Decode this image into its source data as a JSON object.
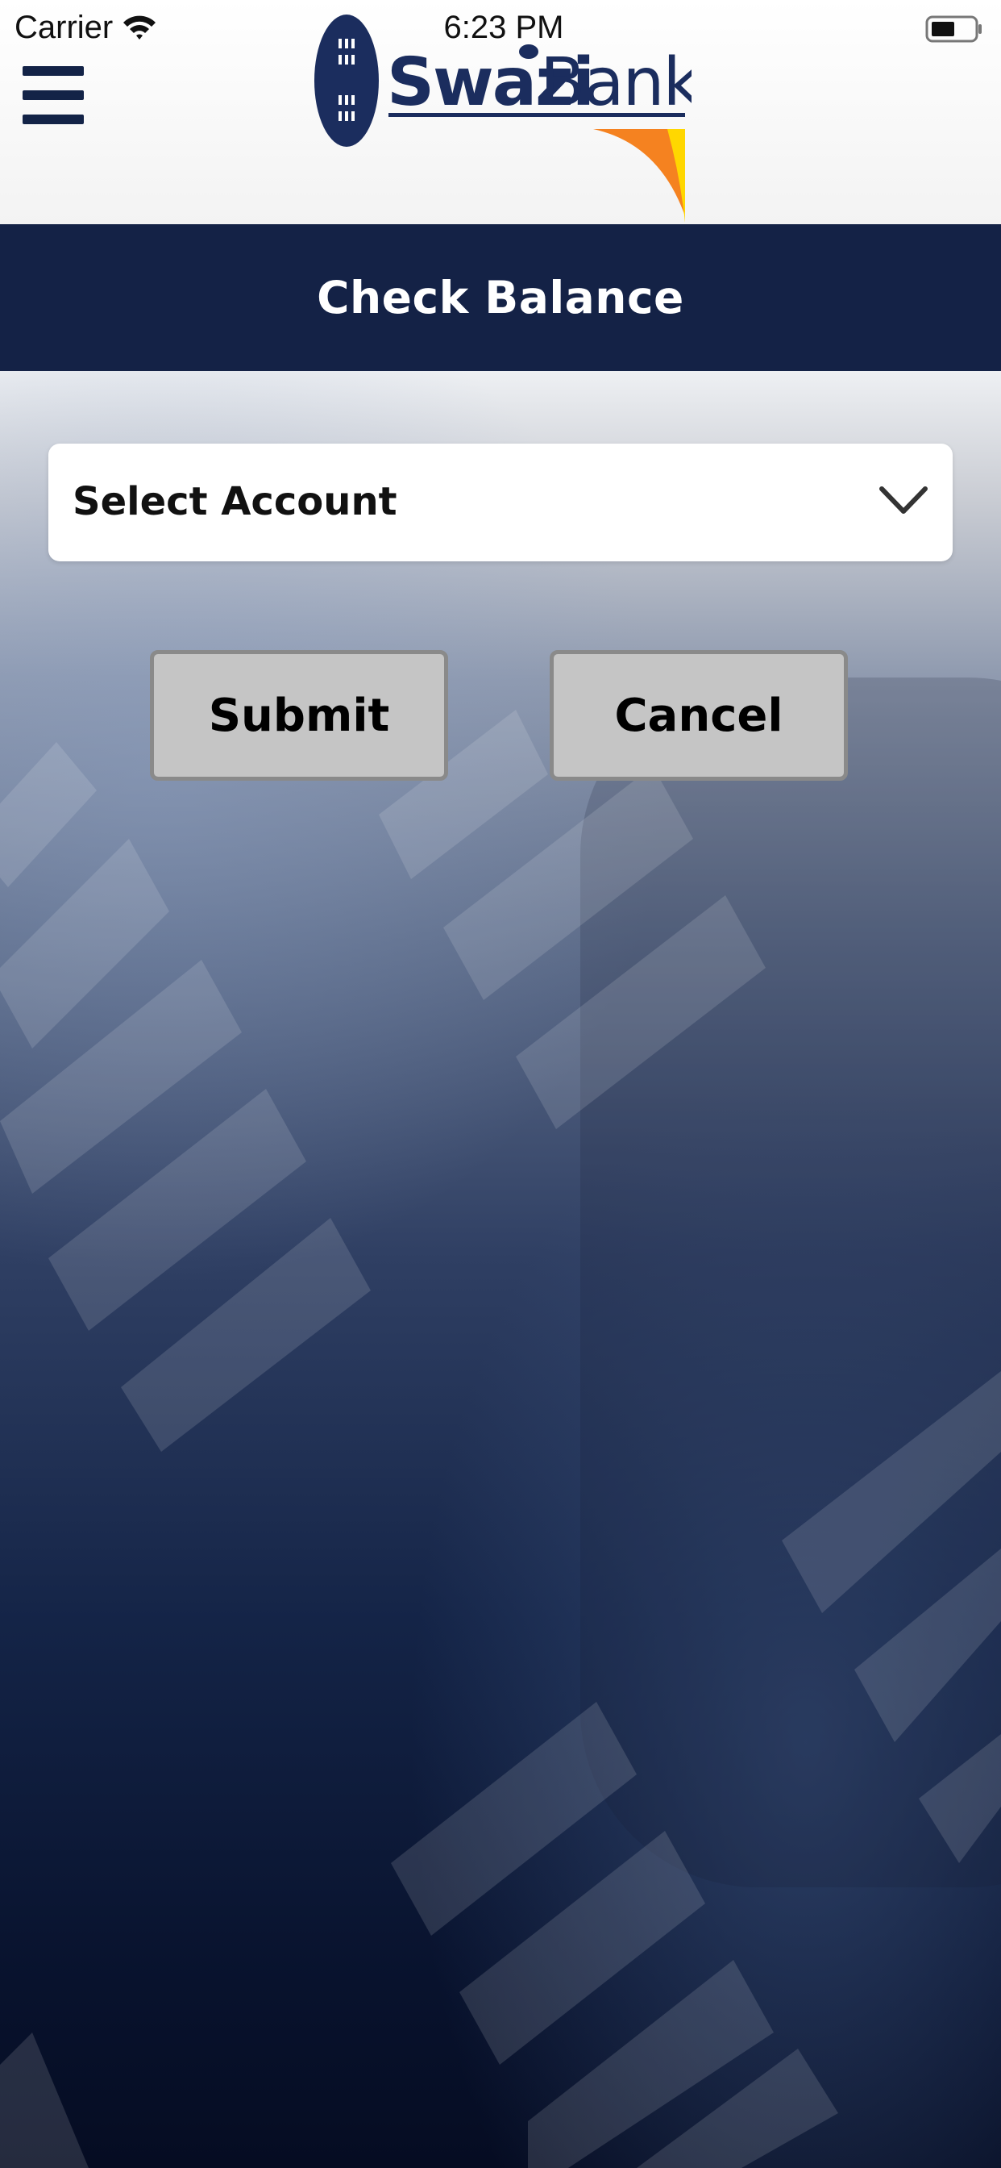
{
  "status_bar": {
    "carrier": "Carrier",
    "time": "6:23 PM",
    "wifi_icon": "wifi-icon",
    "battery_icon": "battery-icon"
  },
  "header": {
    "menu_icon": "hamburger-menu-icon",
    "logo": {
      "text_primary": "Swazi",
      "text_secondary": "Bank",
      "brand_color": "#1b2d5e",
      "accent_orange": "#f58220",
      "accent_yellow": "#ffd700"
    }
  },
  "title_bar": {
    "title": "Check Balance",
    "background": "#142246"
  },
  "form": {
    "account_select": {
      "label": "Select Account",
      "icon": "chevron-down-icon"
    },
    "submit_label": "Submit",
    "cancel_label": "Cancel"
  }
}
